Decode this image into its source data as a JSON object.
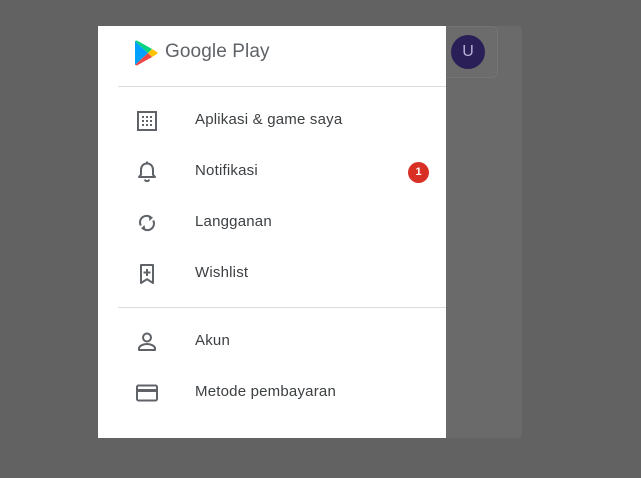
{
  "app": {
    "brand": "Google Play",
    "avatar_initial": "U"
  },
  "colors": {
    "scrim": "#626262",
    "drawer_bg": "#ffffff",
    "icon": "#5f6368",
    "text": "#3c4043",
    "badge": "#d93025",
    "avatar": "#2b1f58"
  },
  "menu": {
    "group1": [
      {
        "label": "Aplikasi & game saya",
        "icon": "grid-icon"
      },
      {
        "label": "Notifikasi",
        "icon": "bell-icon",
        "badge": "1"
      },
      {
        "label": "Langganan",
        "icon": "refresh-icon"
      },
      {
        "label": "Wishlist",
        "icon": "bookmark-add-icon"
      }
    ],
    "group2": [
      {
        "label": "Akun",
        "icon": "person-icon"
      },
      {
        "label": "Metode pembayaran",
        "icon": "credit-card-icon"
      }
    ]
  }
}
